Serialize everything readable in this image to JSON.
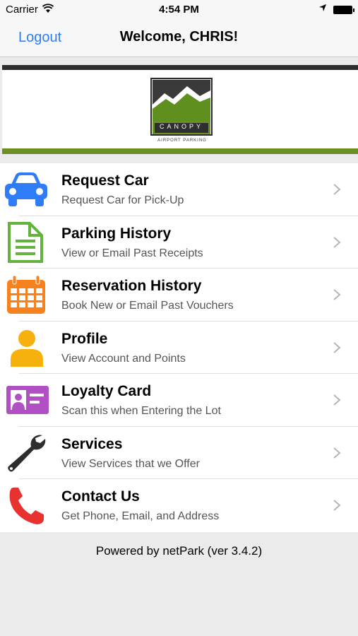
{
  "status_bar": {
    "carrier": "Carrier",
    "time": "4:54 PM"
  },
  "nav": {
    "logout_label": "Logout",
    "title": "Welcome, CHRIS!"
  },
  "banner": {
    "brand": "CANOPY",
    "tagline": "AIRPORT PARKING"
  },
  "menu": [
    {
      "label": "Request Car",
      "sub": "Request Car for Pick-Up",
      "icon": "car-icon",
      "color": "#2f7df6"
    },
    {
      "label": "Parking History",
      "sub": "View or Email Past Receipts",
      "icon": "document-icon",
      "color": "#63b33e"
    },
    {
      "label": "Reservation History",
      "sub": "Book New or Email Past Vouchers",
      "icon": "calendar-icon",
      "color": "#f5821f"
    },
    {
      "label": "Profile",
      "sub": "View Account and Points",
      "icon": "person-icon",
      "color": "#f7b10d"
    },
    {
      "label": "Loyalty Card",
      "sub": "Scan this when Entering the Lot",
      "icon": "id-card-icon",
      "color": "#b14fc5"
    },
    {
      "label": "Services",
      "sub": "View Services that we Offer",
      "icon": "wrench-icon",
      "color": "#2d2d2d"
    },
    {
      "label": "Contact Us",
      "sub": "Get Phone, Email, and Address",
      "icon": "phone-icon",
      "color": "#e8322f"
    }
  ],
  "footer": {
    "text": "Powered by netPark (ver 3.4.2)"
  }
}
